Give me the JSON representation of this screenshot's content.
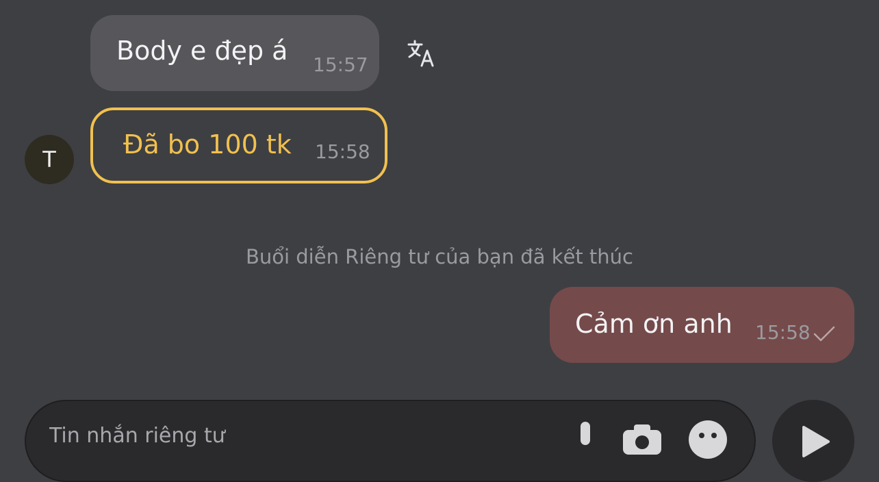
{
  "messages": {
    "incoming": {
      "text": "Body e đẹp á",
      "time": "15:57",
      "action_icon": "translate-icon"
    },
    "tip": {
      "sender_initial": "T",
      "text": "Đã bo 100 tk",
      "time": "15:58",
      "accent_color": "#f1c14f"
    },
    "system_note": "Buổi diễn Riêng tư của bạn đã kết thúc",
    "outgoing": {
      "text": "Cảm ơn anh",
      "time": "15:58",
      "status_icon": "check-icon"
    }
  },
  "composer": {
    "placeholder": "Tin nhắn riêng tư",
    "icons": [
      "mic-icon",
      "camera-icon",
      "emoji-icon"
    ],
    "send_icon": "send-icon"
  },
  "colors": {
    "background": "#3e3f43",
    "incoming_bubble": "#56565b",
    "outgoing_bubble": "#754a4b"
  }
}
